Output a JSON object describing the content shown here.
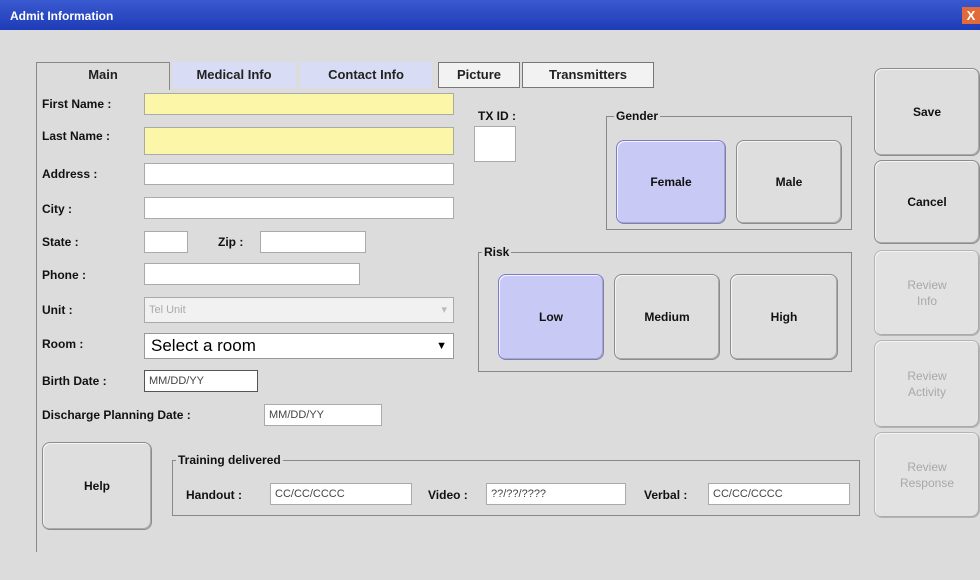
{
  "window": {
    "title": "Admit Information",
    "close_glyph": "X"
  },
  "tabs": [
    {
      "label": "Main"
    },
    {
      "label": "Medical Info"
    },
    {
      "label": "Contact Info"
    },
    {
      "label": "Picture"
    },
    {
      "label": "Transmitters"
    }
  ],
  "form": {
    "first_name": {
      "label": "First Name :",
      "value": ""
    },
    "last_name": {
      "label": "Last Name :",
      "value": ""
    },
    "address": {
      "label": "Address :",
      "value": ""
    },
    "city": {
      "label": "City :",
      "value": ""
    },
    "state": {
      "label": "State :",
      "value": ""
    },
    "zip": {
      "label": "Zip :",
      "value": ""
    },
    "phone": {
      "label": "Phone :",
      "value": ""
    },
    "unit": {
      "label": "Unit :",
      "value": "Tel Unit"
    },
    "room": {
      "label": "Room :",
      "value": "Select a room"
    },
    "birth_date": {
      "label": "Birth Date :",
      "value": "MM/DD/YY"
    },
    "discharge_date": {
      "label": "Discharge Planning Date :",
      "value": "MM/DD/YY"
    },
    "tx_id": {
      "label": "TX ID :",
      "value": ""
    }
  },
  "gender": {
    "title": "Gender",
    "options": [
      "Female",
      "Male"
    ],
    "selected": "Female"
  },
  "risk": {
    "title": "Risk",
    "options": [
      "Low",
      "Medium",
      "High"
    ],
    "selected": "Low"
  },
  "training": {
    "title": "Training delivered",
    "handout": {
      "label": "Handout :",
      "value": "CC/CC/CCCC"
    },
    "video": {
      "label": "Video :",
      "value": "??/??/????"
    },
    "verbal": {
      "label": "Verbal :",
      "value": "CC/CC/CCCC"
    }
  },
  "actions": {
    "save": "Save",
    "cancel": "Cancel",
    "review_info": "Review Info",
    "review_activity": "Review Activity",
    "review_response": "Review Response",
    "help": "Help"
  },
  "colors": {
    "required_field": "#fbf6a8",
    "selected_button": "#c8caf5",
    "titlebar": "#1d3bb6"
  }
}
